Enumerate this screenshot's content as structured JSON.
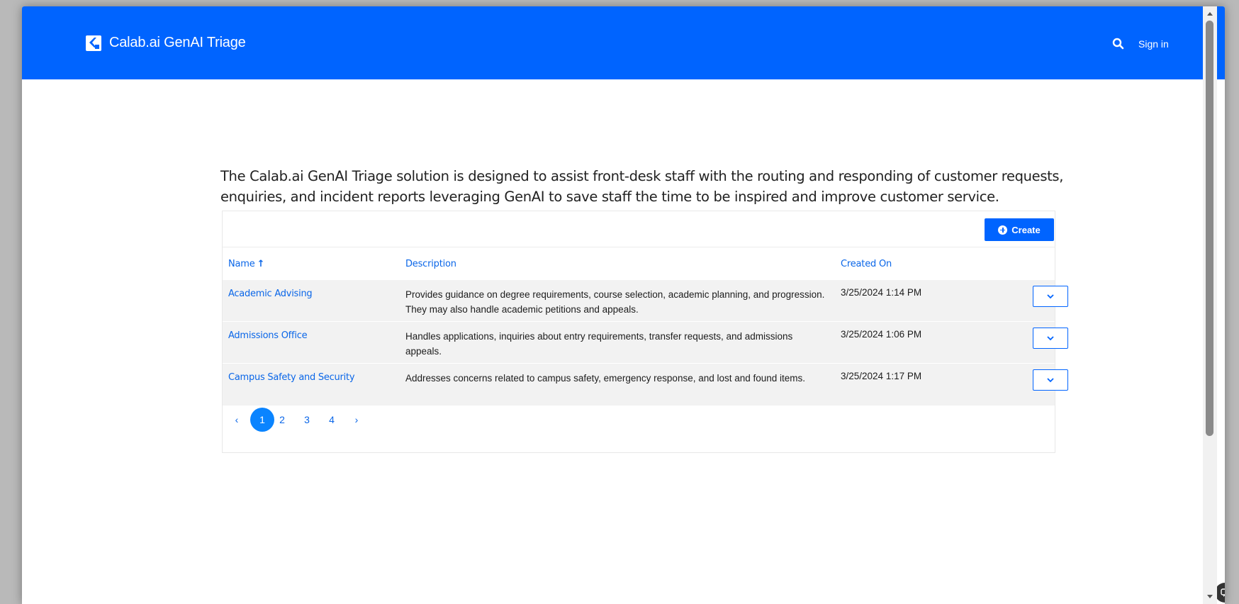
{
  "header": {
    "brand": "Calab.ai GenAI Triage",
    "sign_in": "Sign in",
    "background_color": "#0064ff"
  },
  "intro": {
    "line1": "The Calab.ai GenAI Triage solution is designed to assist front-desk staff with the routing and responding of customer requests,",
    "line2": "enquiries, and incident reports leveraging GenAI to save staff the time to be inspired and improve customer service."
  },
  "toolbar": {
    "create_label": "Create",
    "create_icon": "plus-circle-icon"
  },
  "table": {
    "columns": {
      "name": "Name",
      "name_sort_icon": "arrow-up-icon",
      "description": "Description",
      "created_on": "Created On"
    },
    "rows": [
      {
        "name": "Academic Advising",
        "description": "Provides guidance on degree requirements, course selection, academic planning, and progression. They may also handle academic petitions and appeals.",
        "created_on": "3/25/2024 1:14 PM"
      },
      {
        "name": "Admissions Office",
        "description": "Handles applications, inquiries about entry requirements, transfer requests, and admissions appeals.",
        "created_on": "3/25/2024 1:06 PM"
      },
      {
        "name": "Campus Safety and Security",
        "description": "Addresses concerns related to campus safety, emergency response, and lost and found items.",
        "created_on": "3/25/2024 1:17 PM"
      }
    ]
  },
  "pagination": {
    "prev": "‹",
    "pages": [
      "1",
      "2",
      "3",
      "4"
    ],
    "current": "1",
    "next": "›"
  },
  "colors": {
    "accent": "#0064ff",
    "link": "#0a66e8",
    "row_background": "#f2f2f2"
  }
}
